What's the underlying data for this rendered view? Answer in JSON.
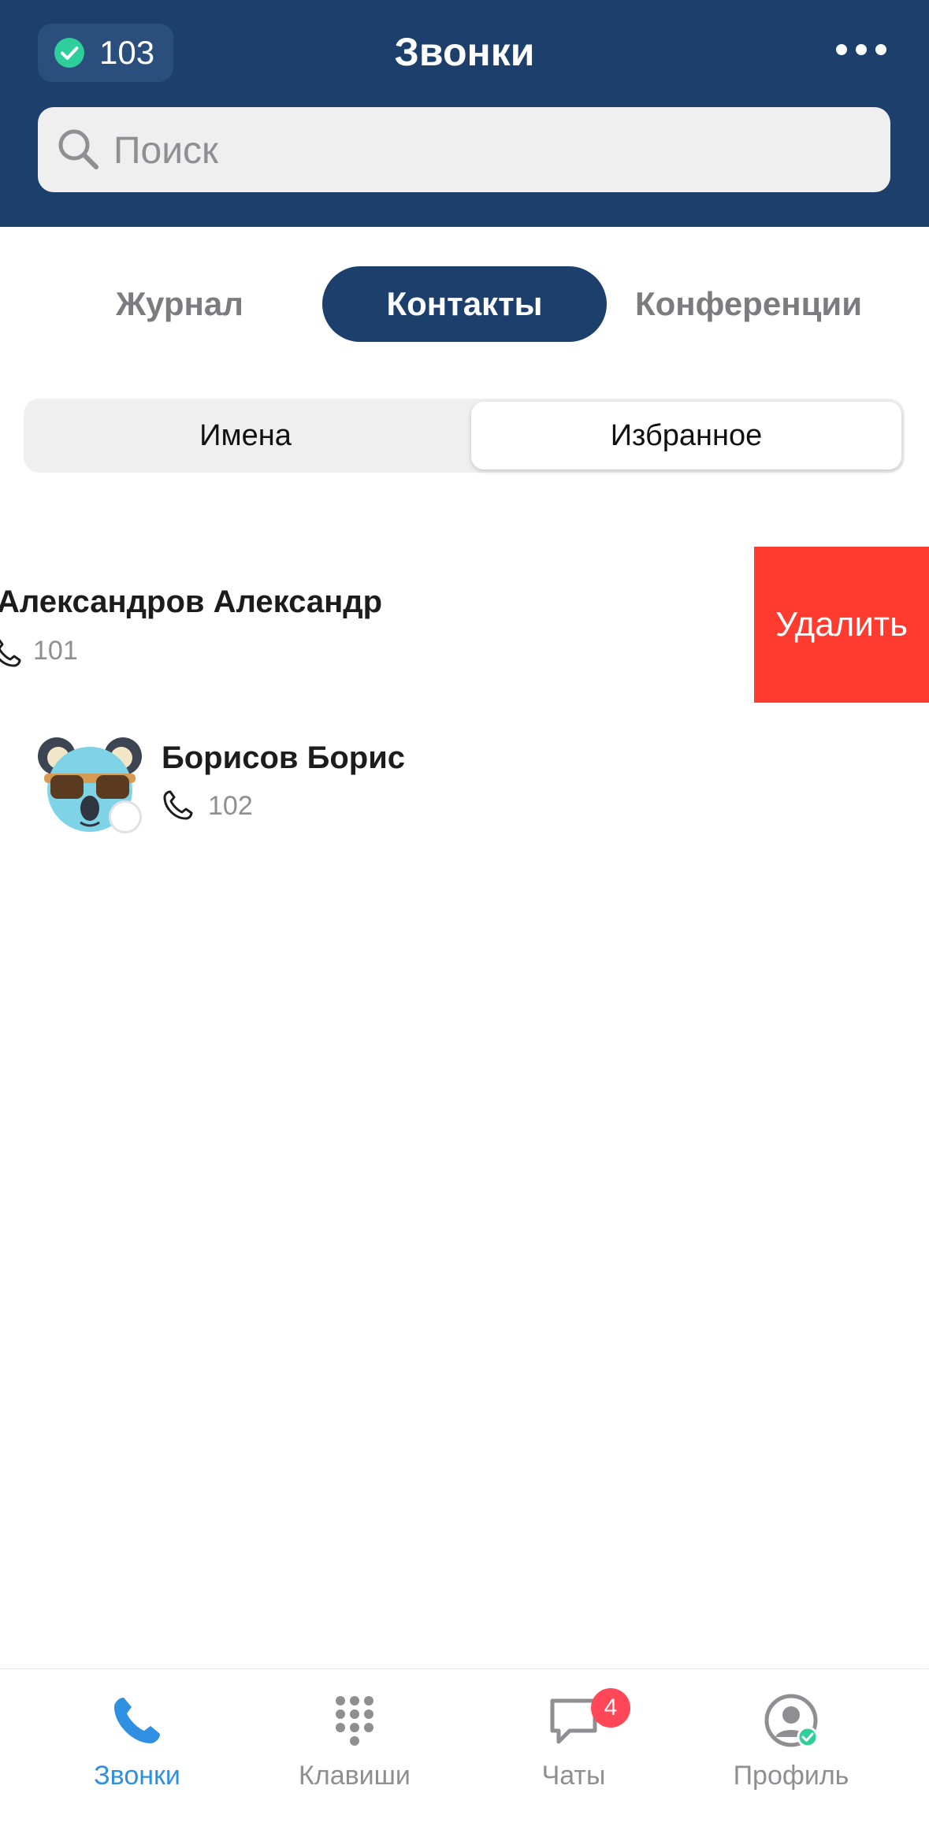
{
  "header": {
    "status_count": "103",
    "title": "Звонки",
    "search_placeholder": "Поиск"
  },
  "tabs": [
    {
      "label": "Журнал",
      "active": false
    },
    {
      "label": "Контакты",
      "active": true
    },
    {
      "label": "Конференции",
      "active": false
    }
  ],
  "segment": [
    {
      "label": "Имена",
      "active": false
    },
    {
      "label": "Избранное",
      "active": true
    }
  ],
  "contacts": [
    {
      "name": "Александров Александр",
      "ext": "101",
      "swipe_action": "Удалить"
    },
    {
      "name": "Борисов Борис",
      "ext": "102"
    }
  ],
  "bottom_nav": [
    {
      "label": "Звонки",
      "icon": "phone-icon",
      "active": true
    },
    {
      "label": "Клавиши",
      "icon": "keypad-icon",
      "active": false
    },
    {
      "label": "Чаты",
      "icon": "chat-icon",
      "active": false,
      "badge": "4"
    },
    {
      "label": "Профиль",
      "icon": "profile-icon",
      "active": false
    }
  ],
  "colors": {
    "header_bg": "#1c3f6b",
    "active_tab_bg": "#1c3f6b",
    "delete_bg": "#ff3b30",
    "nav_active": "#2f8fe0",
    "status_green": "#2ecf9a",
    "badge_red": "#ff4757"
  }
}
